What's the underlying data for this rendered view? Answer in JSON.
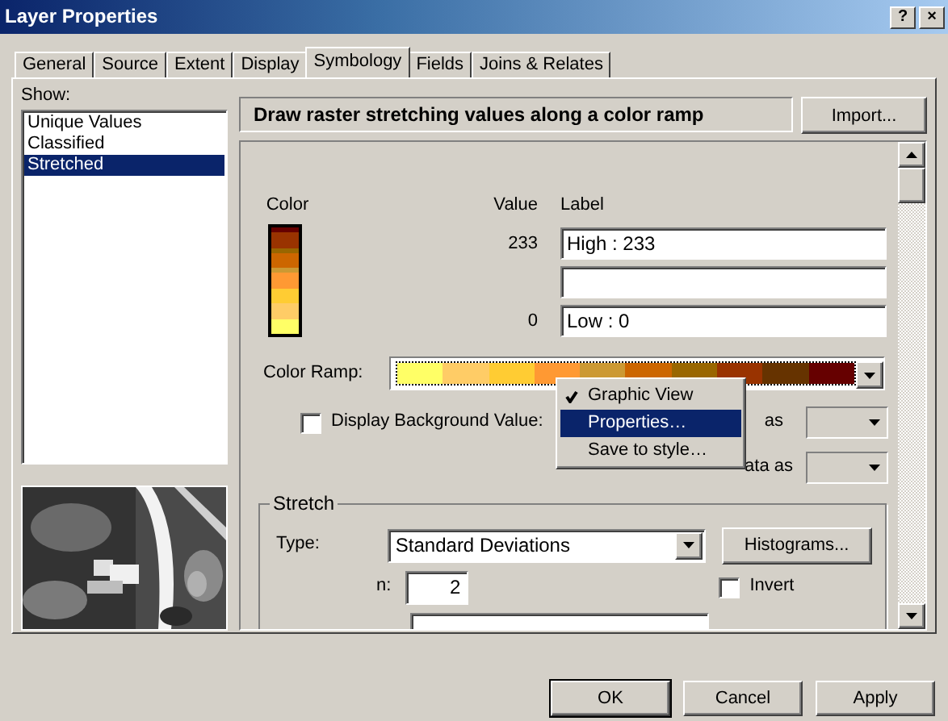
{
  "window": {
    "title": "Layer Properties",
    "buttons": [
      "?",
      "×"
    ]
  },
  "tabs": [
    {
      "label": "General",
      "selected": false
    },
    {
      "label": "Source",
      "selected": false
    },
    {
      "label": "Extent",
      "selected": false
    },
    {
      "label": "Display",
      "selected": false
    },
    {
      "label": "Symbology",
      "selected": true
    },
    {
      "label": "Fields",
      "selected": false
    },
    {
      "label": "Joins & Relates",
      "selected": false
    }
  ],
  "show": {
    "label": "Show:",
    "items": [
      {
        "label": "Unique Values",
        "selected": false
      },
      {
        "label": "Classified",
        "selected": false
      },
      {
        "label": "Stretched",
        "selected": true
      }
    ]
  },
  "header": {
    "description": "Draw raster stretching values along a color ramp",
    "import_button": "Import..."
  },
  "symbology": {
    "color_heading": "Color",
    "value_heading": "Value",
    "label_heading": "Label",
    "rows": [
      {
        "kind": "labeled",
        "value": "233",
        "label": "High : 233"
      },
      {
        "kind": "blank"
      },
      {
        "kind": "labeled",
        "value": "0",
        "label": "Low : 0"
      }
    ],
    "color_scale": [
      {
        "color": "#660000"
      },
      {
        "color": "#993300"
      },
      {
        "color": "#996600"
      },
      {
        "color": "#cc6600"
      },
      {
        "color": "#cc9933"
      },
      {
        "color": "#ff9933"
      },
      {
        "color": "#ffcc33"
      },
      {
        "color": "#ffcc66"
      },
      {
        "color": "#ffff66"
      }
    ]
  },
  "color_ramp": {
    "label": "Color Ramp:",
    "colors": [
      {
        "color": "#ffff66"
      },
      {
        "color": "#ffcc66"
      },
      {
        "color": "#ffcc33"
      },
      {
        "color": "#ff9933"
      },
      {
        "color": "#cc9933"
      },
      {
        "color": "#cc6600"
      },
      {
        "color": "#996600"
      },
      {
        "color": "#993300"
      },
      {
        "color": "#663300"
      },
      {
        "color": "#660000"
      }
    ]
  },
  "background": {
    "label": "Display Background Value:",
    "checked": false,
    "as_label": "as"
  },
  "nodata": {
    "label": "ata as"
  },
  "stretch": {
    "title": "Stretch",
    "type_label": "Type:",
    "type_value": "Standard Deviations",
    "histograms_button": "Histograms...",
    "n_label": "n:",
    "n_value": "2",
    "invert": {
      "label": "Invert",
      "checked": false
    }
  },
  "context_menu": [
    {
      "label": "Graphic View",
      "checked": true,
      "selected": false
    },
    {
      "label": "Properties…",
      "checked": false,
      "selected": true
    },
    {
      "label": "Save to style…",
      "checked": false,
      "selected": false
    }
  ],
  "buttons": [
    {
      "label": "OK",
      "default": true
    },
    {
      "label": "Cancel",
      "default": false
    },
    {
      "label": "Apply",
      "default": false
    }
  ]
}
